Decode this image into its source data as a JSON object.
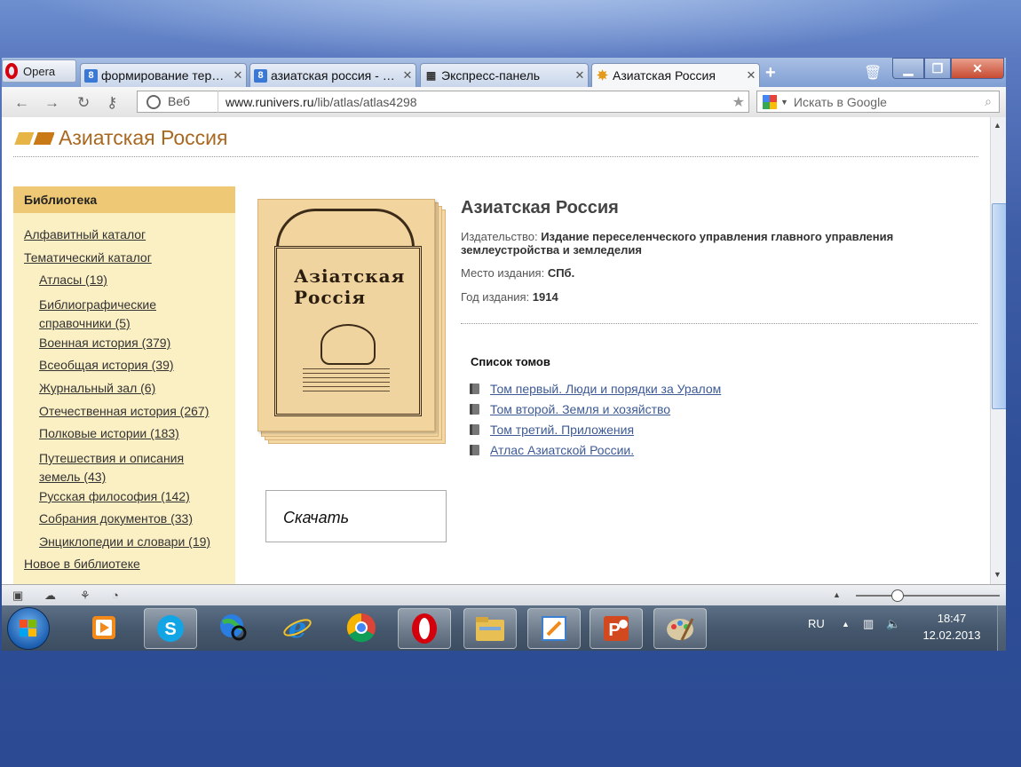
{
  "browser": {
    "menu_label": "Opera",
    "tabs": [
      {
        "title": "формирование тер…",
        "icon": "google-icon",
        "active": false
      },
      {
        "title": "азиатская россия - …",
        "icon": "google-icon",
        "active": false
      },
      {
        "title": "Экспресс-панель",
        "icon": "speed-dial-icon",
        "active": false
      },
      {
        "title": "Азиатская Россия",
        "icon": "site-favicon",
        "active": true
      }
    ],
    "new_tab": "+",
    "address_mode": "Веб",
    "url_domain": "www.runivers.ru",
    "url_path": "/lib/atlas/atlas4298",
    "search_placeholder": "Искать в Google"
  },
  "site": {
    "title": "Азиатская Россия"
  },
  "sidebar": {
    "heading": "Библиотека",
    "items": [
      {
        "label": "Алфавитный каталог",
        "level": 0
      },
      {
        "label": "Тематический каталог",
        "level": 0
      },
      {
        "label": "Атласы (19)",
        "level": 1
      },
      {
        "label": "Библиографические справочники (5)",
        "level": 1
      },
      {
        "label": "Военная история (379)",
        "level": 1
      },
      {
        "label": "Всеобщая история (39)",
        "level": 1
      },
      {
        "label": "Журнальный зал (6)",
        "level": 1
      },
      {
        "label": "Отечественная история (267)",
        "level": 1
      },
      {
        "label": "Полковые истории (183)",
        "level": 1
      },
      {
        "label": "Путешествия и описания земель (43)",
        "level": 1
      },
      {
        "label": "Русская философия (142)",
        "level": 1
      },
      {
        "label": "Собрания документов (33)",
        "level": 1
      },
      {
        "label": "Энциклопедии и словари (19)",
        "level": 1
      },
      {
        "label": "Новое в библиотеке",
        "level": 0
      }
    ]
  },
  "book": {
    "cover_title_line1": "Азiатская",
    "cover_title_line2": "Россiя",
    "title": "Азиатская Россия",
    "publisher_label": "Издательство:",
    "publisher_value": "Издание переселенческого управления главного управления землеустройства и земледелия",
    "place_label": "Место издания:",
    "place_value": "СПб.",
    "year_label": "Год издания:",
    "year_value": "1914",
    "download_label": "Скачать"
  },
  "volumes": {
    "heading": "Список томов",
    "items": [
      "Том первый. Люди и порядки за Уралом",
      "Том второй. Земля и хозяйство",
      "Том третий. Приложения",
      "Атлас Азиатской России."
    ]
  },
  "taskbar": {
    "language": "RU",
    "time": "18:47",
    "date": "12.02.2013",
    "apps": [
      "media-player-icon",
      "skype-icon",
      "globe-search-icon",
      "internet-explorer-icon",
      "chrome-icon",
      "opera-icon",
      "file-explorer-icon",
      "notes-icon",
      "powerpoint-icon",
      "paint-icon"
    ]
  },
  "colors": {
    "site_title": "#a86820",
    "sidebar_bg": "#fbefc4",
    "sidebar_head": "#eec874",
    "link": "#3d5a96"
  }
}
